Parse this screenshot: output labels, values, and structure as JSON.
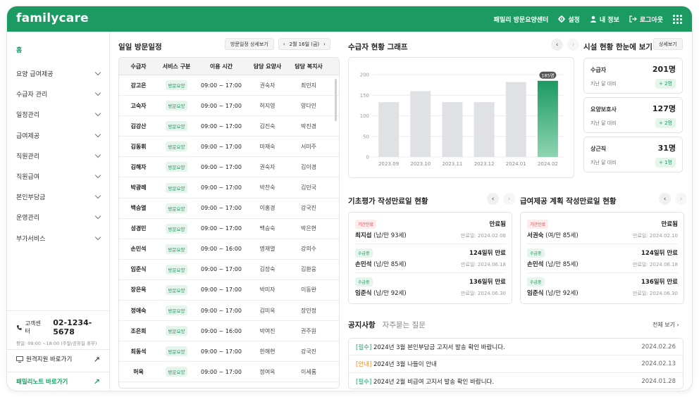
{
  "header": {
    "logo": "familycare",
    "center_name": "패밀리 방문요양센터",
    "settings_label": "설정",
    "profile_label": "내 정보",
    "logout_label": "로그아웃"
  },
  "sidebar": {
    "home": "홈",
    "items": [
      {
        "label": "요양 급여제공"
      },
      {
        "label": "수급자 관리"
      },
      {
        "label": "일정관리"
      },
      {
        "label": "급여제공"
      },
      {
        "label": "직원관리"
      },
      {
        "label": "직원급여"
      },
      {
        "label": "본인부담금"
      },
      {
        "label": "운영관리"
      },
      {
        "label": "부가서비스"
      }
    ],
    "cs_label": "고객센터",
    "cs_phone": "02-1234-5678",
    "cs_hours": "평일: 09:00 ~18:00 (주말/공휴일 휴무)",
    "remote_label": "원격지원 바로가기",
    "note_label": "패밀리노트 바로가기"
  },
  "schedule": {
    "title": "일일 방문일정",
    "detail_btn": "방문일정 상세보기",
    "date": "2월 16일 (금)",
    "columns": [
      "수급자",
      "서비스 구분",
      "이용 시간",
      "담당 요양사",
      "담당 복지사"
    ],
    "rows": [
      {
        "name": "강고은",
        "service": "방문요양",
        "time": "09:00 ~ 17:00",
        "caregiver": "권숙자",
        "worker": "최민지"
      },
      {
        "name": "고숙자",
        "service": "방문요양",
        "time": "09:00 ~ 17:00",
        "caregiver": "허지영",
        "worker": "양다인"
      },
      {
        "name": "김강산",
        "service": "방문요양",
        "time": "09:00 ~ 17:00",
        "caregiver": "김진숙",
        "worker": "박진경"
      },
      {
        "name": "김동휘",
        "service": "방문요양",
        "time": "09:00 ~ 17:00",
        "caregiver": "마재숙",
        "worker": "서미주"
      },
      {
        "name": "김해자",
        "service": "방문요양",
        "time": "09:00 ~ 17:00",
        "caregiver": "권숙자",
        "worker": "김이경"
      },
      {
        "name": "박광례",
        "service": "방문요양",
        "time": "09:00 ~ 17:00",
        "caregiver": "박찬숙",
        "worker": "김민국"
      },
      {
        "name": "백승열",
        "service": "방문요양",
        "time": "09:00 ~ 17:00",
        "caregiver": "이홍경",
        "worker": "강국진"
      },
      {
        "name": "성경민",
        "service": "방문요양",
        "time": "09:00 ~ 17:00",
        "caregiver": "백승숙",
        "worker": "박은현"
      },
      {
        "name": "손민석",
        "service": "방문요양",
        "time": "09:00 ~ 16:00",
        "caregiver": "명재열",
        "worker": "강의수"
      },
      {
        "name": "임준식",
        "service": "방문요양",
        "time": "09:00 ~ 17:00",
        "caregiver": "김장숙",
        "worker": "김환웅"
      },
      {
        "name": "장은옥",
        "service": "방문요양",
        "time": "09:00 ~ 17:00",
        "caregiver": "박미자",
        "worker": "이동완"
      },
      {
        "name": "정애숙",
        "service": "방문요양",
        "time": "09:00 ~ 17:00",
        "caregiver": "김미옥",
        "worker": "장민정"
      },
      {
        "name": "조은희",
        "service": "방문요양",
        "time": "09:00 ~ 16:00",
        "caregiver": "박여진",
        "worker": "권주원"
      },
      {
        "name": "최동석",
        "service": "방문요양",
        "time": "09:00 ~ 17:00",
        "caregiver": "한해현",
        "worker": "강국진"
      },
      {
        "name": "허욱",
        "service": "방문요양",
        "time": "09:00 ~ 17:00",
        "caregiver": "정여옥",
        "worker": "이세롬"
      }
    ]
  },
  "chart_section": {
    "title": "수급자 현황 그래프"
  },
  "chart_data": {
    "type": "bar",
    "categories": [
      "2023.09",
      "2023.10",
      "2023.11",
      "2023.12",
      "2024.01",
      "2024.02"
    ],
    "values": [
      133,
      160,
      133,
      133,
      182,
      185
    ],
    "ylim": [
      0,
      200
    ],
    "yticks": [
      "0",
      "50",
      "100",
      "150",
      "200"
    ],
    "highlight_label": "185명",
    "colors": {
      "bar": "#dfe1e4",
      "highlight": "#1b9a62"
    },
    "grid": true
  },
  "facility": {
    "title": "시설 현황 한눈에 보기",
    "detail_btn": "상세보기",
    "cards": [
      {
        "label": "수급자",
        "value": "201명",
        "sub": "지난 달 대비",
        "delta": "+ 2명"
      },
      {
        "label": "요양보호사",
        "value": "127명",
        "sub": "지난 달 대비",
        "delta": "+ 2명"
      },
      {
        "label": "상근직",
        "value": "31명",
        "sub": "지난 달 대비",
        "delta": "+ 1명"
      }
    ]
  },
  "basic_eval": {
    "title": "기초평가 작성만료일 현황",
    "items": [
      {
        "tag": "기간만료",
        "tag_type": "warn",
        "status": "만료됨",
        "name": "최지섭",
        "info": "(남/만 93세)",
        "date": "만료일: 2024.02.08"
      },
      {
        "tag": "수급중",
        "tag_type": "ok",
        "status": "124일뒤 만료",
        "name": "손민석",
        "info": "(남/만 85세)",
        "date": "만료일: 2024.06.18"
      },
      {
        "tag": "수급중",
        "tag_type": "ok",
        "status": "136일뒤 만료",
        "name": "임준식",
        "info": "(남/만 92세)",
        "date": "만료일: 2024.06.30"
      }
    ]
  },
  "plan_eval": {
    "title": "급여제공 계획 작성만료일 현황",
    "items": [
      {
        "tag": "기간만료",
        "tag_type": "warn",
        "status": "만료됨",
        "name": "서권숙",
        "info": "(여/만 85세)",
        "date": "만료일: 2024.02.10"
      },
      {
        "tag": "수급중",
        "tag_type": "ok",
        "status": "124일뒤 만료",
        "name": "손민석",
        "info": "(남/만 85세)",
        "date": "만료일: 2024.06.18"
      },
      {
        "tag": "수급중",
        "tag_type": "ok",
        "status": "136일뒤 만료",
        "name": "임준식",
        "info": "(남/만 92세)",
        "date": "만료일: 2024.06.30"
      }
    ]
  },
  "notice": {
    "tab_active": "공지사항",
    "tab_inactive": "자주묻는 질문",
    "view_all": "전체 보기",
    "items": [
      {
        "tag": "[필수]",
        "tag_type": "g",
        "text": "2024년 3월 본인부담금 고지서 발송 확인 바랍니다.",
        "date": "2024.02.26"
      },
      {
        "tag": "[안내]",
        "tag_type": "o",
        "text": "2024년 3월 나들이 안내",
        "date": "2024.02.13"
      },
      {
        "tag": "[필수]",
        "tag_type": "g",
        "text": "2024년 2월 비급여 고지서 발송 확인 바랍니다.",
        "date": "2024.01.28"
      }
    ]
  }
}
